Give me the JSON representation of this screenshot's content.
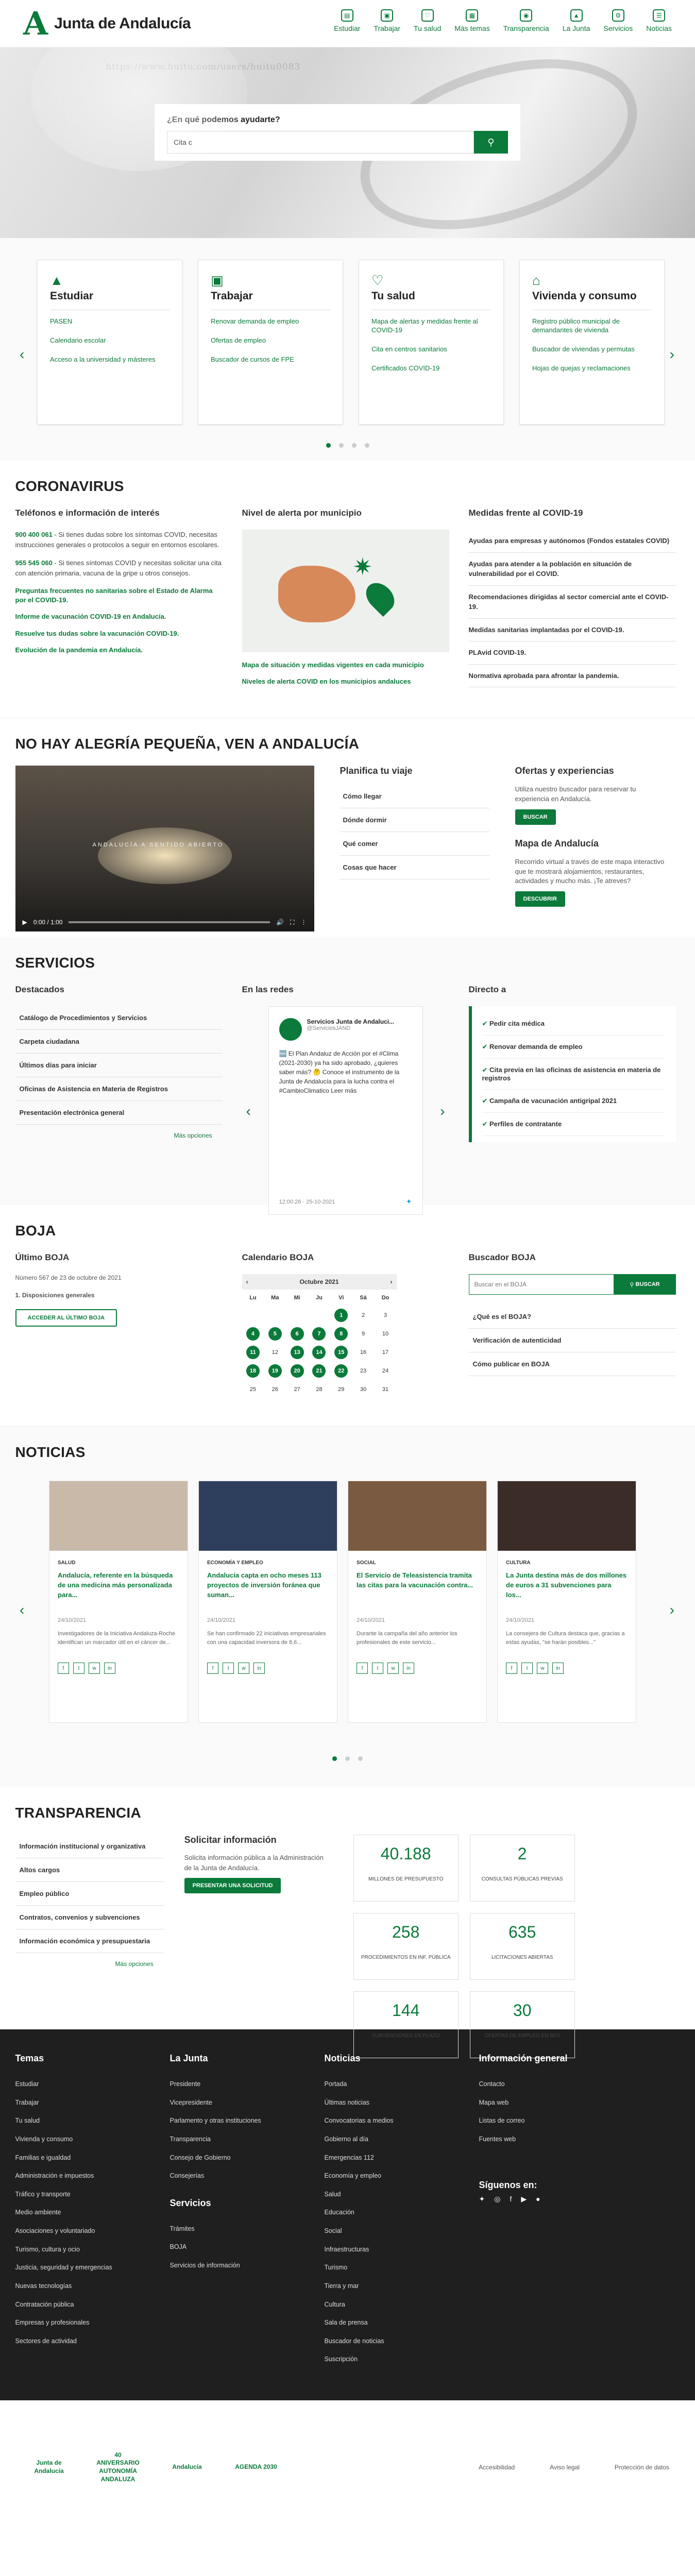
{
  "header": {
    "title": "Junta de Andalucía",
    "nav": [
      {
        "label": "Estudiar",
        "icon": "book-icon"
      },
      {
        "label": "Trabajar",
        "icon": "briefcase-icon"
      },
      {
        "label": "Tu salud",
        "icon": "heart-icon"
      },
      {
        "label": "Más temas",
        "icon": "grid-icon"
      },
      {
        "label": "Transparencia",
        "icon": "eye-icon"
      },
      {
        "label": "La Junta",
        "icon": "building-icon"
      },
      {
        "label": "Servicios",
        "icon": "services-icon"
      },
      {
        "label": "Noticias",
        "icon": "news-icon"
      }
    ]
  },
  "hero": {
    "watermark": "https://www.huitu.com/users/huitu0083",
    "search_label": "¿En qué podemos ayudarte?",
    "search_placeholder": "Cita c"
  },
  "categories": [
    {
      "title": "Estudiar",
      "icon": "cap-icon",
      "links": [
        "PASEN",
        "Calendario escolar",
        "Acceso a la universidad y másteres"
      ]
    },
    {
      "title": "Trabajar",
      "icon": "briefcase-icon",
      "links": [
        "Renovar demanda de empleo",
        "Ofertas de empleo",
        "Buscador de cursos de FPE"
      ]
    },
    {
      "title": "Tu salud",
      "icon": "heart-icon",
      "links": [
        "Mapa de alertas y medidas frente al COVID-19",
        "Cita en centros sanitarios",
        "Certificados COVID-19"
      ]
    },
    {
      "title": "Vivienda y consumo",
      "icon": "house-icon",
      "links": [
        "Registro público municipal de demandantes de vivienda",
        "Buscador de viviendas y permutas",
        "Hojas de quejas y reclamaciones"
      ]
    }
  ],
  "covid": {
    "title": "CORONAVIRUS",
    "col1_title": "Teléfonos e información de interés",
    "phones": [
      {
        "num": "900 400 061",
        "text": " - Si tienes dudas sobre los síntomas COVID, necesitas instrucciones generales o protocolos a seguir en entornos escolares."
      },
      {
        "num": "955 545 060",
        "text": " - Si tienes síntomas COVID y necesitas solicitar una cita con atención primaria, vacuna de la gripe u otros consejos."
      }
    ],
    "links1": [
      "Preguntas frecuentes no sanitarias sobre el Estado de Alarma por el COVID-19.",
      "Informe de vacunación COVID-19 en Andalucía.",
      "Resuelve tus dudas sobre la vacunación COVID-19.",
      "Evolución de la pandemia en Andalucía."
    ],
    "col2_title": "Nivel de alerta por municipio",
    "links2": [
      "Mapa de situación y medidas vigentes en cada municipio",
      "Niveles de alerta COVID en los municipios andaluces"
    ],
    "col3_title": "Medidas frente al COVID-19",
    "measures": [
      "Ayudas para empresas y autónomos (Fondos estatales COVID)",
      "Ayudas para atender a la población en situación de vulnerabilidad por el COVID.",
      "Recomendaciones dirigidas al sector comercial ante el COVID-19.",
      "Medidas sanitarias implantadas por el COVID-19.",
      "PLAvid COVID-19.",
      "Normativa aprobada para afrontar la pandemia."
    ]
  },
  "alegria": {
    "title": "NO HAY ALEGRÍA PEQUEÑA, VEN A ANDALUCÍA",
    "video_caption": "ANDALUCÍA A SENTIDO ABIERTO",
    "video_time": "0:00 / 1:00",
    "plan_title": "Planifica tu viaje",
    "plan_links": [
      "Cómo llegar",
      "Dónde dormir",
      "Qué comer",
      "Cosas que hacer"
    ],
    "offers_title": "Ofertas y experiencias",
    "offers_text": "Utiliza nuestro buscador para reservar tu experiencia en Andalucía.",
    "offers_btn": "BUSCAR",
    "map_title": "Mapa de Andalucía",
    "map_text": "Recorrido virtual a través de este mapa interactivo que te mostrará alojamientos, restaurantes, actividades y mucho más. ¡Te atreves?",
    "map_btn": "DESCUBRIR"
  },
  "servicios": {
    "title": "SERVICIOS",
    "featured_title": "Destacados",
    "featured": [
      "Catálogo de Procedimientos y Servicios",
      "Carpeta ciudadana",
      "Últimos días para iniciar",
      "Oficinas de Asistencia en Materia de Registros",
      "Presentación electrónica general"
    ],
    "more": "Más opciones",
    "social_title": "En las redes",
    "tweet": {
      "name": "Servicios Junta de Andaluci...",
      "handle": "@ServiciosJAND",
      "text": "🆕 El Plan Andaluz de Acción por el #Clima (2021-2030) ya ha sido aprobado, ¿quieres saber más? 🤔 Conoce el instrumento de la Junta de Andalucía para la lucha contra el #CambioClimatico Leer más",
      "date": "12:00:26 · 25-10-2021"
    },
    "direct_title": "Directo a",
    "direct": [
      "Pedir cita médica",
      "Renovar demanda de empleo",
      "Cita previa en las oficinas de asistencia en materia de registros",
      "Campaña de vacunación antigripal 2021",
      "Perfiles de contratante"
    ]
  },
  "boja": {
    "title": "BOJA",
    "last_title": "Último BOJA",
    "number": "Número 567 de 23 de octubre de 2021",
    "section": "1. Disposiciones generales",
    "btn": "ACCEDER AL ÚLTIMO BOJA",
    "cal_title": "Calendario BOJA",
    "month": "Octubre 2021",
    "weekdays": [
      "Lu",
      "Ma",
      "Mi",
      "Ju",
      "Vi",
      "Sá",
      "Do"
    ],
    "weeks": [
      [
        "",
        "",
        "",
        "",
        "1",
        "2",
        "3"
      ],
      [
        "4",
        "5",
        "6",
        "7",
        "8",
        "9",
        "10"
      ],
      [
        "11",
        "12",
        "13",
        "14",
        "15",
        "16",
        "17"
      ],
      [
        "18",
        "19",
        "20",
        "21",
        "22",
        "23",
        "24"
      ],
      [
        "25",
        "26",
        "27",
        "28",
        "29",
        "30",
        "31"
      ]
    ],
    "on_days": [
      "1",
      "4",
      "5",
      "6",
      "7",
      "8",
      "11",
      "13",
      "14",
      "15",
      "18",
      "19",
      "20",
      "21",
      "22"
    ],
    "search_title": "Buscador BOJA",
    "search_placeholder": "Buscar en el BOJA",
    "search_btn": "BUSCAR",
    "search_links": [
      "¿Qué es el BOJA?",
      "Verificación de autenticidad",
      "Cómo publicar en BOJA"
    ]
  },
  "noticias": {
    "title": "NOTICIAS",
    "items": [
      {
        "cat": "SALUD",
        "title": "Andalucía, referente en la búsqueda de una medicina más personalizada para...",
        "date": "24/10/2021",
        "text": "Investigadores de la Iniciativa Andaluza-Roche identifican un marcador útil en el cáncer de...",
        "color": "#c9b9a8"
      },
      {
        "cat": "ECONOMÍA Y EMPLEO",
        "title": "Andalucía capta en ocho meses 113 proyectos de inversión foránea que suman...",
        "date": "24/10/2021",
        "text": "Se han confirmado 22 iniciativas empresariales con una capacidad inversora de 8,6...",
        "color": "#2e3f5e"
      },
      {
        "cat": "SOCIAL",
        "title": "El Servicio de Teleasistencia tramita las citas para la vacunación contra...",
        "date": "24/10/2021",
        "text": "Durante la campaña del año anterior los profesionales de este servicio...",
        "color": "#7a5a40"
      },
      {
        "cat": "CULTURA",
        "title": "La Junta destina más de dos millones de euros a 31 subvenciones para los...",
        "date": "24/10/2021",
        "text": "La consejera de Cultura destaca que, gracias a estas ayudas, \"se harán posibles...\"",
        "color": "#3b2c28"
      }
    ]
  },
  "transparencia": {
    "title": "TRANSPARENCIA",
    "links": [
      "Información institucional y organizativa",
      "Altos cargos",
      "Empleo público",
      "Contratos, convenios y subvenciones",
      "Información económica y presupuestaria"
    ],
    "more": "Más opciones",
    "req_title": "Solicitar información",
    "req_text": "Solicita información pública a la Administración de la Junta de Andalucía.",
    "req_btn": "PRESENTAR UNA SOLICITUD",
    "stats": [
      {
        "n": "40.188",
        "l": "MILLONES DE PRESUPUESTO"
      },
      {
        "n": "2",
        "l": "CONSULTAS PÚBLICAS PREVIAS"
      },
      {
        "n": "258",
        "l": "PROCEDIMIENTOS EN INF. PÚBLICA"
      },
      {
        "n": "635",
        "l": "LICITACIONES ABIERTAS"
      },
      {
        "n": "144",
        "l": "SUBVENCIONES EN PLAZO"
      },
      {
        "n": "30",
        "l": "OFERTAS DE EMPLEO EN BEV"
      }
    ]
  },
  "footer": {
    "cols": [
      {
        "title": "Temas",
        "links": [
          "Estudiar",
          "Trabajar",
          "Tu salud",
          "Vivienda y consumo",
          "Familias e igualdad",
          "Administración e impuestos",
          "Tráfico y transporte",
          "Medio ambiente",
          "Asociaciones y voluntariado",
          "Turismo, cultura y ocio",
          "Justicia, seguridad y emergencias",
          "Nuevas tecnologías",
          "Contratación pública",
          "Empresas y profesionales",
          "Sectores de actividad"
        ]
      },
      {
        "title": "La Junta",
        "links": [
          "Presidente",
          "Vicepresidente",
          "Parlamento y otras instituciones",
          "Transparencia",
          "Consejo de Gobierno",
          "Consejerías"
        ],
        "sub_title": "Servicios",
        "sub_links": [
          "Trámites",
          "BOJA",
          "Servicios de información"
        ]
      },
      {
        "title": "Noticias",
        "links": [
          "Portada",
          "Últimas noticias",
          "Convocatorias a medios",
          "Gobierno al día",
          "Emergencias 112",
          "Economía y empleo",
          "Salud",
          "Educación",
          "Social",
          "Infraestructuras",
          "Turismo",
          "Tierra y mar",
          "Cultura",
          "Sala de prensa",
          "Buscador de noticias",
          "Suscripción"
        ]
      },
      {
        "title": "Información general",
        "links": [
          "Contacto",
          "Mapa web",
          "Listas de correo",
          "Fuentes web"
        ],
        "follow": "Síguenos en:"
      }
    ]
  },
  "bottom": {
    "logos": [
      "Junta de Andalucía",
      "40 ANIVERSARIO AUTONOMÍA ANDALUZA",
      "Andalucía",
      "AGENDA 2030"
    ],
    "links": [
      "Accesibilidad",
      "Aviso legal",
      "Protección de datos"
    ]
  }
}
